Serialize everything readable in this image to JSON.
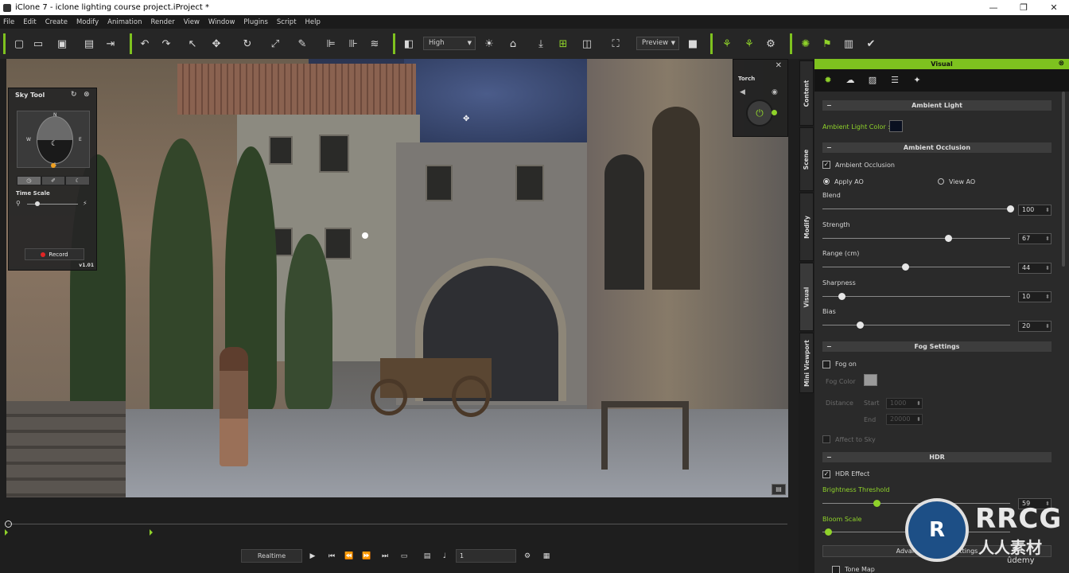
{
  "window": {
    "title": "iClone 7 - iclone lighting course project.iProject *",
    "min": "—",
    "max": "❐",
    "close": "✕"
  },
  "menu": [
    "File",
    "Edit",
    "Create",
    "Modify",
    "Animation",
    "Render",
    "View",
    "Window",
    "Plugins",
    "Script",
    "Help"
  ],
  "toolbar": {
    "quality": "High",
    "render_mode": "Preview",
    "icons": [
      "new-icon",
      "open-icon",
      "save-icon",
      "render-icon",
      "export-icon",
      "undo-icon",
      "redo-icon",
      "select-icon",
      "move-icon",
      "rotate-icon",
      "scale-icon",
      "eraser-icon",
      "align-icon",
      "align-icon",
      "hide-icon",
      "view-icon",
      "sun-icon",
      "home-icon",
      "drop-icon",
      "snap-icon",
      "camera-icon",
      "frame-icon",
      "video-icon",
      "light-icon",
      "light-icon",
      "light-icon",
      "effect-icon",
      "flag-icon",
      "clipboard-icon",
      "wrench-icon"
    ],
    "accent": "#7ec21f"
  },
  "sky_tool": {
    "title": "Sky Tool",
    "compass": {
      "n": "N",
      "s": "S",
      "w": "W",
      "e": "E"
    },
    "time_scale_label": "Time Scale",
    "time_scale": 0.15,
    "record": "Record",
    "version": "v1.01"
  },
  "torch": {
    "title": "Torch",
    "close": "✕"
  },
  "timeline": {
    "realtime": "Realtime",
    "frame": "1",
    "buttons": [
      "play-icon",
      "first-frame-icon",
      "prev-key-icon",
      "next-key-icon",
      "last-frame-icon",
      "loop-icon",
      "subtitle-icon",
      "sound-icon"
    ]
  },
  "vtabs": [
    "Content",
    "Scene",
    "Modify",
    "Visual",
    "Mini Viewport"
  ],
  "visual": {
    "title": "Visual",
    "ambient_light": {
      "header": "Ambient Light",
      "color_label": "Ambient Light Color :",
      "color": "#0a1020"
    },
    "ambient_occlusion": {
      "header": "Ambient Occlusion",
      "enabled_label": "Ambient Occlusion",
      "apply_ao": "Apply AO",
      "view_ao": "View AO",
      "blend_label": "Blend",
      "blend": "100",
      "strength_label": "Strength",
      "strength": "67",
      "range_label": "Range (cm)",
      "range": "44",
      "sharpness_label": "Sharpness",
      "sharpness": "10",
      "bias_label": "Bias",
      "bias": "20"
    },
    "fog": {
      "header": "Fog Settings",
      "on_label": "Fog on",
      "color_label": "Fog Color",
      "distance_label": "Distance",
      "start_label": "Start",
      "start": "1000",
      "end_label": "End",
      "end": "20000",
      "affect_sky": "Affect to Sky"
    },
    "hdr": {
      "header": "HDR",
      "effect_label": "HDR Effect",
      "brightness_label": "Brightness Threshold",
      "brightness": "59",
      "bloom_label": "Bloom Scale",
      "advanced": "Advanced Bloom Settings",
      "tone_map": "Tone Map"
    }
  },
  "watermark": {
    "mark": "R",
    "big": "RRCG",
    "small": "人人素材",
    "udemy": "ûdemy"
  }
}
